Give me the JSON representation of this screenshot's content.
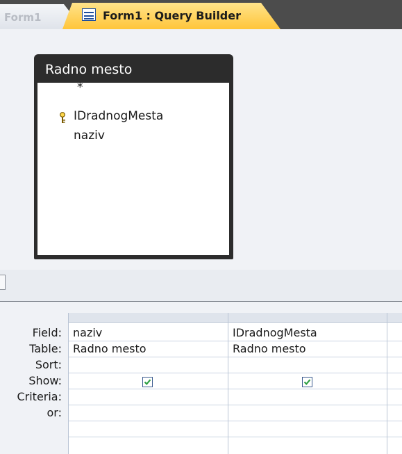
{
  "tabs": {
    "inactive_label": "Form1",
    "active_label": "Form1 : Query Builder"
  },
  "table_box": {
    "title": "Radno mesto",
    "fields": [
      "*",
      "IDradnogMesta",
      "naziv"
    ],
    "primary_key_field": "IDradnogMesta"
  },
  "grid": {
    "row_labels": {
      "field": "Field:",
      "table": "Table:",
      "sort": "Sort:",
      "show": "Show:",
      "criteria": "Criteria:",
      "or": "or:"
    },
    "columns": [
      {
        "field": "naziv",
        "table": "Radno mesto",
        "sort": "",
        "show": true,
        "criteria": "",
        "or": ""
      },
      {
        "field": "IDradnogMesta",
        "table": "Radno mesto",
        "sort": "",
        "show": true,
        "criteria": "",
        "or": ""
      }
    ]
  },
  "colors": {
    "active_tab": "#ffc53a",
    "table_header": "#2c2c2c",
    "checkbox_check": "#2ea043"
  }
}
